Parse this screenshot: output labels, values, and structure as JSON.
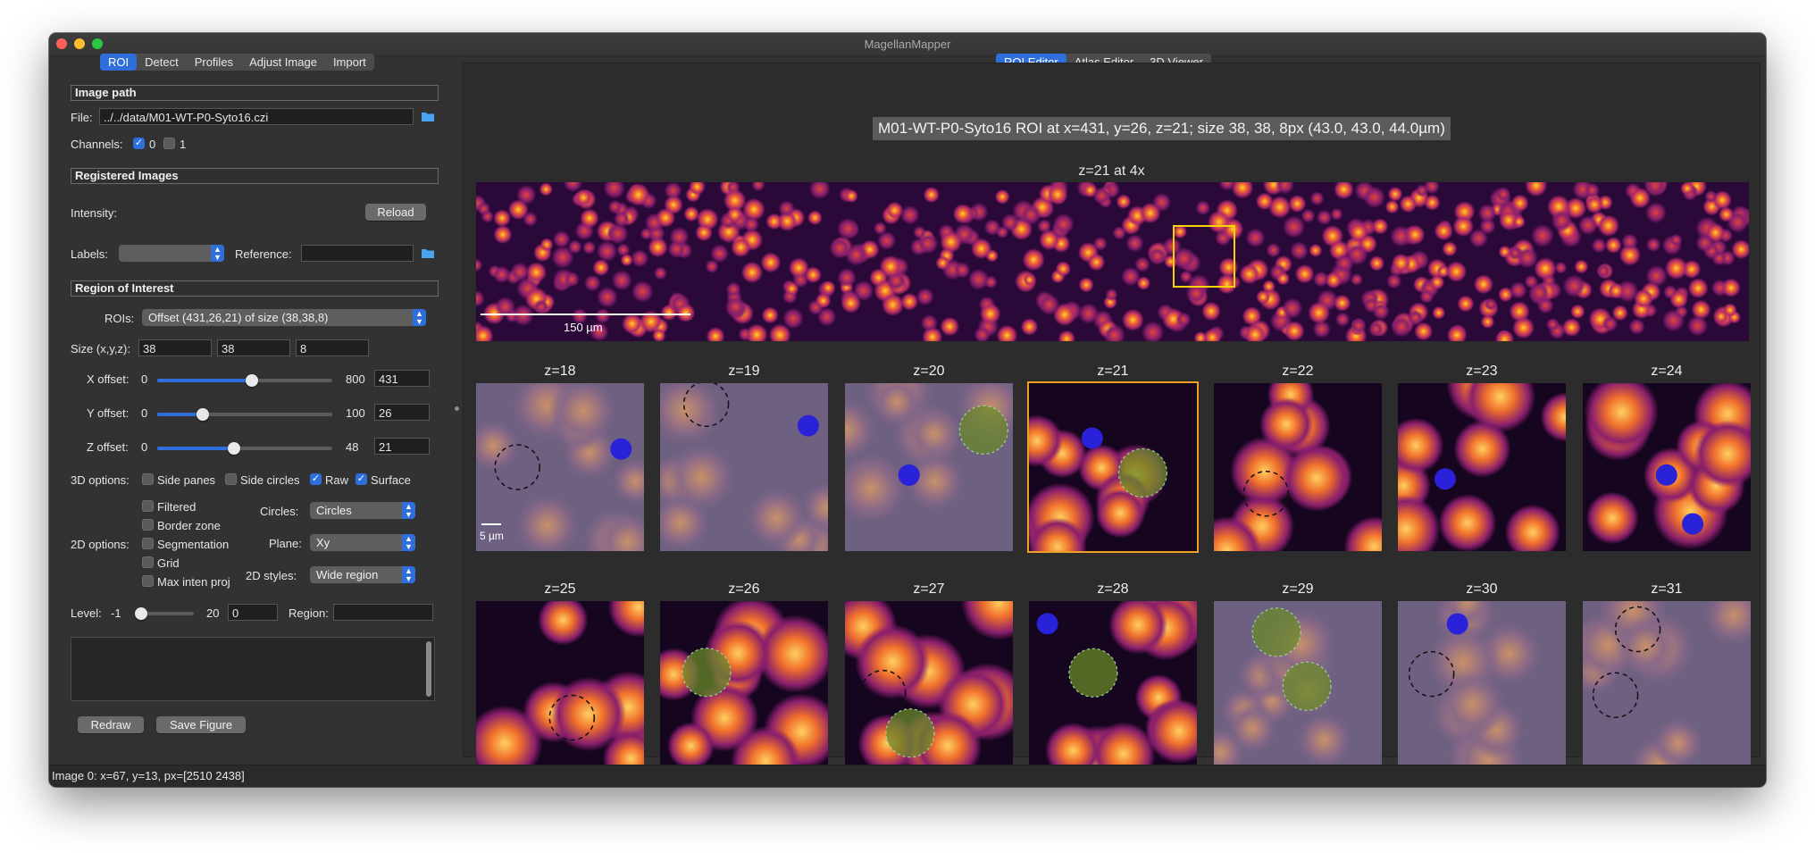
{
  "window": {
    "title": "MagellanMapper"
  },
  "left_tabs": [
    "ROI",
    "Detect",
    "Profiles",
    "Adjust Image",
    "Import"
  ],
  "right_tabs": [
    "ROI Editor",
    "Atlas Editor",
    "3D Viewer"
  ],
  "panel": {
    "image_path_section": "Image path",
    "file_label": "File:",
    "file_value": "../../data/M01-WT-P0-Syto16.czi",
    "channels_label": "Channels:",
    "channel0": "0",
    "channel1": "1",
    "registered_section": "Registered Images",
    "intensity_label": "Intensity:",
    "reload_button": "Reload",
    "labels_label": "Labels:",
    "reference_label": "Reference:",
    "roi_section": "Region of Interest",
    "rois_label": "ROIs:",
    "rois_value": "Offset (431,26,21) of size (38,38,8)",
    "size_label": "Size (x,y,z):",
    "size_x": "38",
    "size_y": "38",
    "size_z": "8",
    "x_offset": {
      "label": "X offset:",
      "min": "0",
      "max": "800",
      "value": "431",
      "fraction": 0.539
    },
    "y_offset": {
      "label": "Y offset:",
      "min": "0",
      "max": "100",
      "value": "26",
      "fraction": 0.26
    },
    "z_offset": {
      "label": "Z offset:",
      "min": "0",
      "max": "48",
      "value": "21",
      "fraction": 0.4375
    },
    "options3d_label": "3D options:",
    "opt_side_panes": "Side panes",
    "opt_side_circles": "Side circles",
    "opt_raw": "Raw",
    "opt_surface": "Surface",
    "options2d_label": "2D options:",
    "opt_filtered": "Filtered",
    "opt_border_zone": "Border zone",
    "opt_segmentation": "Segmentation",
    "opt_grid": "Grid",
    "opt_max_inten": "Max inten proj",
    "circles_label": "Circles:",
    "circles_value": "Circles",
    "plane_label": "Plane:",
    "plane_value": "Xy",
    "styles_label": "2D styles:",
    "styles_value": "Wide region",
    "level_label": "Level:",
    "level_min": "-1",
    "level_max": "20",
    "level_value": "0",
    "region_label": "Region:",
    "redraw_button": "Redraw",
    "save_button": "Save Figure"
  },
  "viewer": {
    "roi_title": "M01-WT-P0-Syto16 ROI at x=431, y=26, z=21; size 38, 38, 8px (43.0, 43.0, 44.0µm)",
    "overview_label": "z=21 at 4x",
    "overview_scale": "150 µm",
    "tile_scale": "5 µm",
    "row1": [
      "z=18",
      "z=19",
      "z=20",
      "z=21",
      "z=22",
      "z=23",
      "z=24"
    ],
    "row2": [
      "z=25",
      "z=26",
      "z=27",
      "z=28",
      "z=29",
      "z=30",
      "z=31"
    ]
  },
  "status": {
    "text": "Image 0: x=67, y=13, px=[2510 2438]"
  },
  "colors": {
    "accent": "#2f6fdc",
    "roi_box": "#f5d400",
    "selected_tile": "#f0a020"
  }
}
